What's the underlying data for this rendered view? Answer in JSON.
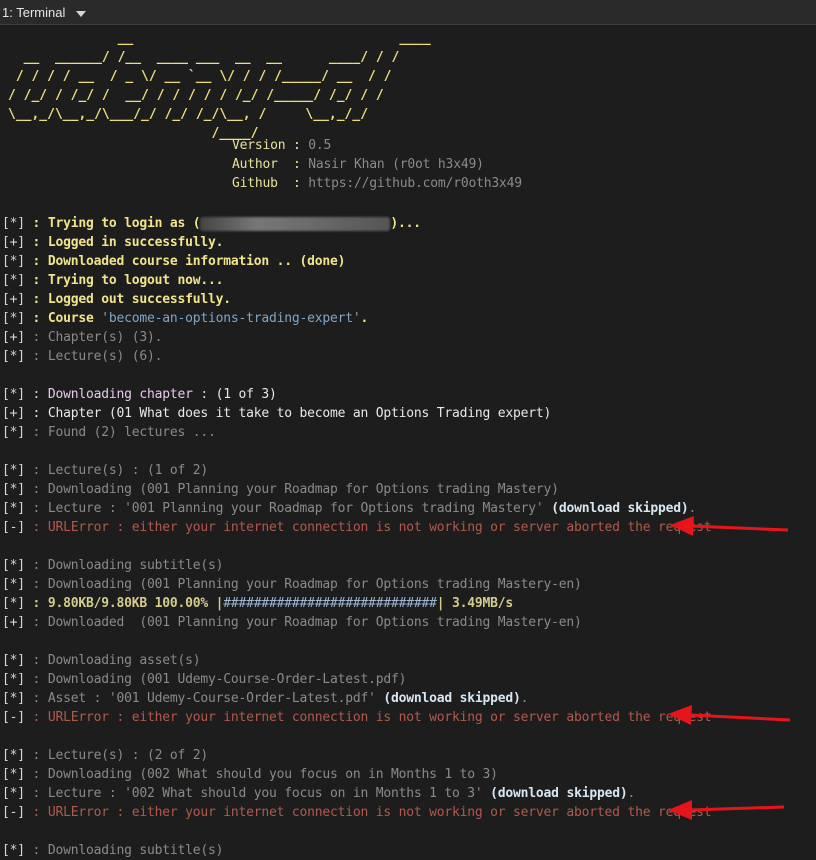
{
  "titlebar": {
    "title": "1: Terminal"
  },
  "banner": {
    "art": "              __                                  ____\n  __  ______/ /__  ____ ___  __  __      ____/ / /\n / / / / __  / _ \\/ __ `__ \\/ / / /_____/ __  / /\n/ /_/ / /_/ /  __/ / / / / / /_/ /_____/ /_/ / /\n\\__,_/\\__,_/\\___/_/ /_/ /_/\\__, /     \\__,_/_/\n                          /____/",
    "version_label": "Version",
    "version_value": "0.5",
    "author_label": "Author",
    "author_value": "Nasir Khan (r0ot h3x49)",
    "github_label": "Github",
    "github_value": "https://github.com/r0oth3x49"
  },
  "lines": [
    {
      "mark": "*",
      "pre": "Trying to login as (",
      "post": ")...",
      "style": "bright",
      "redacted": true
    },
    {
      "mark": "+",
      "text": "Logged in successfully.",
      "style": "bright"
    },
    {
      "mark": "*",
      "text": "Downloaded course information .. (done)",
      "style": "bright"
    },
    {
      "mark": "*",
      "text": "Trying to logout now...",
      "style": "bright"
    },
    {
      "mark": "+",
      "text": "Logged out successfully.",
      "style": "bright"
    },
    {
      "mark": "*",
      "pre": "Course ",
      "quoted": "'become-an-options-trading-expert'",
      "post": ".",
      "style": "bright"
    },
    {
      "mark": "+",
      "text": "Chapter(s) (3).",
      "style": "dim"
    },
    {
      "mark": "*",
      "text": "Lecture(s) (6).",
      "style": "dim"
    },
    {
      "mark": "*",
      "pre": "Downloading chapter : ",
      "post": "(1 of 3)",
      "style": "purple"
    },
    {
      "mark": "+",
      "text": "Chapter (01 What does it take to become an Options Trading expert)",
      "style": "white"
    },
    {
      "mark": "*",
      "text": "Found (2) lectures ...",
      "style": "dim"
    },
    {
      "mark": "*",
      "text": "Lecture(s) : (1 of 2)",
      "style": "dim"
    },
    {
      "mark": "*",
      "text": "Downloading (001 Planning your Roadmap for Options trading Mastery)",
      "style": "dim"
    },
    {
      "mark": "*",
      "pre": "Lecture : '001 Planning your Roadmap for Options trading Mastery' ",
      "skip": "(download skipped)",
      "post": ".",
      "style": "dim"
    },
    {
      "mark": "-",
      "text": "URLError : either your internet connection is not working or server aborted the request",
      "style": "err"
    },
    {
      "mark": "*",
      "text": "Downloading subtitle(s)",
      "style": "dim"
    },
    {
      "mark": "*",
      "text": "Downloading (001 Planning your Roadmap for Options trading Mastery-en)",
      "style": "dim"
    },
    {
      "mark": "*",
      "pre": "9.80KB/9.80KB 100.00% |",
      "bar": "############################",
      "post": "| 3.49MB/s",
      "style": "green"
    },
    {
      "mark": "+",
      "text": "Downloaded  (001 Planning your Roadmap for Options trading Mastery-en)",
      "style": "dim"
    },
    {
      "mark": "*",
      "text": "Downloading asset(s)",
      "style": "dim"
    },
    {
      "mark": "*",
      "text": "Downloading (001 Udemy-Course-Order-Latest.pdf)",
      "style": "dim"
    },
    {
      "mark": "*",
      "pre": "Asset : '001 Udemy-Course-Order-Latest.pdf' ",
      "skip": "(download skipped)",
      "post": ".",
      "style": "dim"
    },
    {
      "mark": "-",
      "text": "URLError : either your internet connection is not working or server aborted the request",
      "style": "err"
    },
    {
      "mark": "*",
      "text": "Lecture(s) : (2 of 2)",
      "style": "dim"
    },
    {
      "mark": "*",
      "text": "Downloading (002 What should you focus on in Months 1 to 3)",
      "style": "dim"
    },
    {
      "mark": "*",
      "pre": "Lecture : '002 What should you focus on in Months 1 to 3' ",
      "skip": "(download skipped)",
      "post": ".",
      "style": "dim"
    },
    {
      "mark": "-",
      "text": "URLError : either your internet connection is not working or server aborted the request",
      "style": "err"
    },
    {
      "mark": "*",
      "text": "Downloading subtitle(s)",
      "style": "dim"
    }
  ],
  "colors": {
    "background": "#1d1d1d",
    "banner": "#f0e07a",
    "error": "#b05a4b",
    "arrow": "#e8141c"
  },
  "icons": [
    "chevron-down-icon",
    "red-arrow-annotation"
  ]
}
